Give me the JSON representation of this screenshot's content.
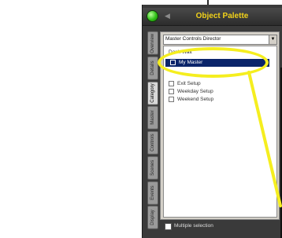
{
  "palette": {
    "title": "Object Palette",
    "dropdown": {
      "value": "Master Controls Director",
      "arrow": "▼"
    },
    "side_tabs": [
      "Overview",
      "Details",
      "Category",
      "Master",
      "Controls",
      "Scenes",
      "Events",
      "Display"
    ],
    "active_tab_index": 2,
    "list_items": [
      {
        "label": "Dash Wait"
      },
      {
        "label": "My Master",
        "selected": true
      },
      {
        "label": "Exit Setup"
      },
      {
        "label": "Weekday Setup"
      },
      {
        "label": "Weekend Setup"
      }
    ],
    "multiple_selection_label": "Multiple selection"
  },
  "colors": {
    "callout": "#f5ee1f",
    "title": "#f2d21a",
    "selection": "#0a246a"
  }
}
